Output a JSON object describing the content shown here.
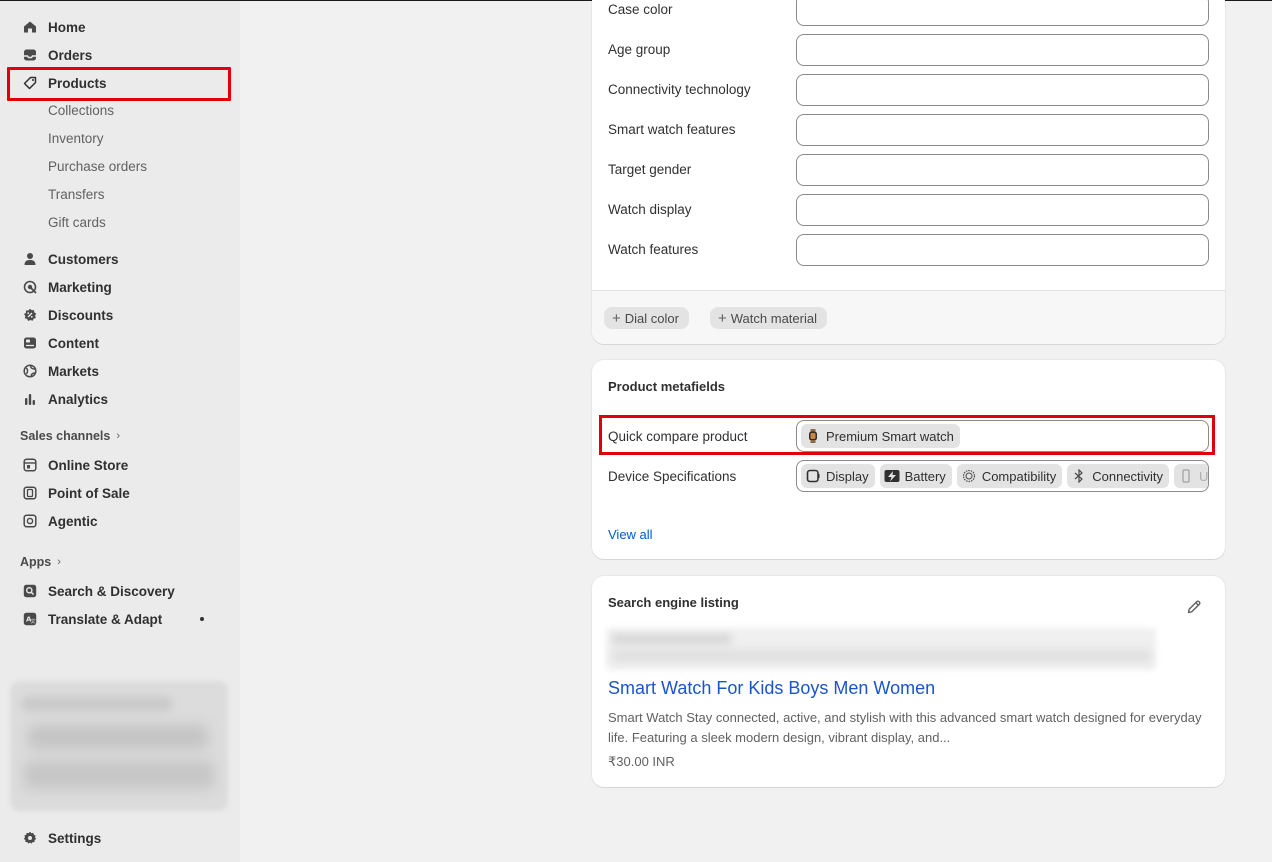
{
  "sidebar": {
    "main_items": [
      {
        "label": "Home",
        "icon": "home-icon"
      },
      {
        "label": "Orders",
        "icon": "inbox-icon"
      },
      {
        "label": "Products",
        "icon": "tag-icon"
      }
    ],
    "product_sub_items": [
      "Collections",
      "Inventory",
      "Purchase orders",
      "Transfers",
      "Gift cards"
    ],
    "more_items": [
      {
        "label": "Customers",
        "icon": "person-icon"
      },
      {
        "label": "Marketing",
        "icon": "target-icon"
      },
      {
        "label": "Discounts",
        "icon": "discount-icon"
      },
      {
        "label": "Content",
        "icon": "content-icon"
      },
      {
        "label": "Markets",
        "icon": "globe-icon"
      },
      {
        "label": "Analytics",
        "icon": "bar-chart-icon"
      }
    ],
    "sales_channels_heading": "Sales channels",
    "sales_channels": [
      {
        "label": "Online Store",
        "icon": "store-icon"
      },
      {
        "label": "Point of Sale",
        "icon": "pos-icon"
      },
      {
        "label": "Agentic",
        "icon": "agentic-icon"
      }
    ],
    "apps_heading": "Apps",
    "apps": [
      {
        "label": "Search & Discovery",
        "icon": "search-icon"
      },
      {
        "label": "Translate & Adapt",
        "icon": "translate-icon"
      }
    ],
    "settings_label": "Settings"
  },
  "attributes": {
    "rows": [
      "Case color",
      "Age group",
      "Connectivity technology",
      "Smart watch features",
      "Target gender",
      "Watch display",
      "Watch features"
    ],
    "add_chips": [
      "Dial color",
      "Watch material"
    ]
  },
  "metafields": {
    "title": "Product metafields",
    "quick_compare_label": "Quick compare product",
    "quick_compare_value": "Premium Smart watch",
    "device_specs_label": "Device Specifications",
    "device_specs": [
      "Display",
      "Battery",
      "Compatibility",
      "Connectivity",
      "US"
    ],
    "view_all": "View all"
  },
  "seo": {
    "title": "Search engine listing",
    "page_title": "Smart Watch For Kids Boys Men Women",
    "description": "Smart Watch Stay connected, active, and stylish with this advanced smart watch designed for everyday life. Featuring a sleek modern design, vibrant display, and...",
    "price": "₹30.00 INR"
  },
  "colors": {
    "highlight": "#e0000b",
    "link": "#005bd3",
    "seo_title": "#1a55c8"
  }
}
